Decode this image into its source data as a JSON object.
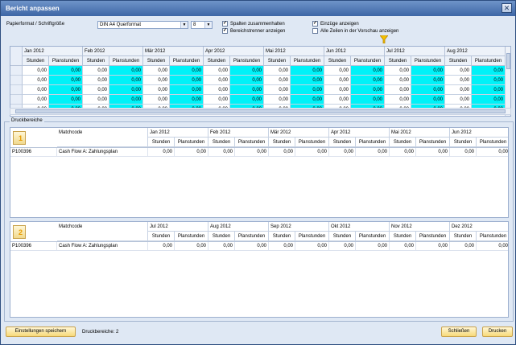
{
  "window": {
    "title": "Bericht anpassen",
    "close_glyph": "✕"
  },
  "settings": {
    "paper_label": "Papierformat / Schriftgröße",
    "paper_value": "DIN A4 Querformat",
    "font_size_value": "8",
    "checkboxes": [
      {
        "label": "Spalten zusammenhalten",
        "checked": true
      },
      {
        "label": "Bereichstrenner anzeigen",
        "checked": true
      },
      {
        "label": "Einzüge anzeigen",
        "checked": true
      },
      {
        "label": "Alle Zeilen in der Vorschau anzeigen",
        "checked": false
      }
    ]
  },
  "preview": {
    "months": [
      "Jan 2012",
      "Feb 2012",
      "Mär 2012",
      "Apr 2012",
      "Mai 2012",
      "Jun 2012",
      "Jul 2012",
      "Aug 2012"
    ],
    "sub_headers": [
      "Stunden",
      "Planstunden"
    ],
    "cell_value": "0,00",
    "row_count": 5,
    "colors": {
      "highlight": "#00f2f8"
    }
  },
  "druckbereiche": {
    "title": "Druckbereiche",
    "areas": [
      {
        "number": "1",
        "matchcode_label": "Matchcode",
        "months": [
          "Jan 2012",
          "Feb 2012",
          "Mär 2012",
          "Apr 2012",
          "Mai 2012",
          "Jun 2012"
        ],
        "sub_headers": [
          "Stunden",
          "Planstunden"
        ],
        "row_id": "P100396",
        "row_name": "Cash Flow A: Zahlungsplan",
        "cell_value": "0,00"
      },
      {
        "number": "2",
        "matchcode_label": "Matchcode",
        "months": [
          "Jul 2012",
          "Aug 2012",
          "Sep 2012",
          "Okt 2012",
          "Nov 2012",
          "Dez 2012"
        ],
        "sub_headers": [
          "Stunden",
          "Planstunden"
        ],
        "row_id": "P100396",
        "row_name": "Cash Flow A: Zahlungsplan",
        "cell_value": "0,00"
      }
    ]
  },
  "footer": {
    "save_label": "Einstellungen speichern",
    "count_label": "Druckbereiche: 2",
    "close_label": "Schließen",
    "print_label": "Drucken"
  },
  "icons": {
    "filter": "filter-funnel-icon",
    "area_number": "page-number-icon"
  }
}
